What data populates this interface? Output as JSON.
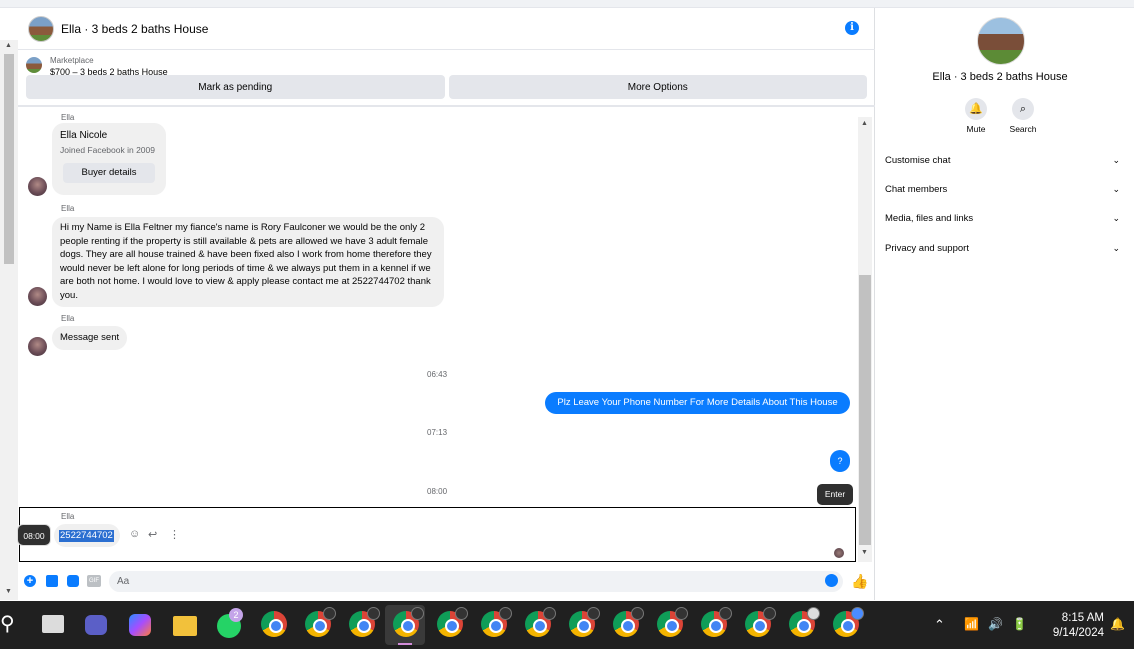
{
  "chat": {
    "title": "Ella · 3 beds 2 baths House",
    "marketplace_label": "Marketplace",
    "listing_title": "$700 – 3 beds 2 baths House",
    "mark_pending": "Mark as pending",
    "more_options": "More Options"
  },
  "messages": {
    "sender": "Ella",
    "card_name": "Ella Nicole",
    "card_sub": "Joined Facebook in 2009",
    "card_button": "Buyer details",
    "long_text": "Hi my Name is Ella Feltner my fiance's name is Rory Faulconer we would be the only 2 people renting if the property is still available & pets are allowed we have 3 adult female dogs. They are all house trained & have been fixed also I work from home therefore they would never be left alone for long periods of time & we always put them in a kennel if we are both not home. I would love to view & apply please contact me at 2522744702 thank you.",
    "message_sent": "Message sent",
    "time1": "06:43",
    "outgoing1": "Plz Leave Your Phone Number For More Details About This House",
    "time2": "07:13",
    "outgoing2": "?",
    "time3": "08:00",
    "enter_tooltip": "Enter",
    "time_tooltip": "08:00",
    "selected_text": "2522744702"
  },
  "composer": {
    "placeholder": "Aa",
    "gif_label": "GIF"
  },
  "info_panel": {
    "title": "Ella · 3 beds 2 baths House",
    "mute": "Mute",
    "search": "Search",
    "rows": [
      "Customise chat",
      "Chat members",
      "Media, files and links",
      "Privacy and support"
    ]
  },
  "taskbar": {
    "whatsapp_badge": "2",
    "time": "8:15 AM",
    "date": "9/14/2024"
  },
  "colors": {
    "accent": "#0a7cff",
    "taskbar": "#202020"
  }
}
